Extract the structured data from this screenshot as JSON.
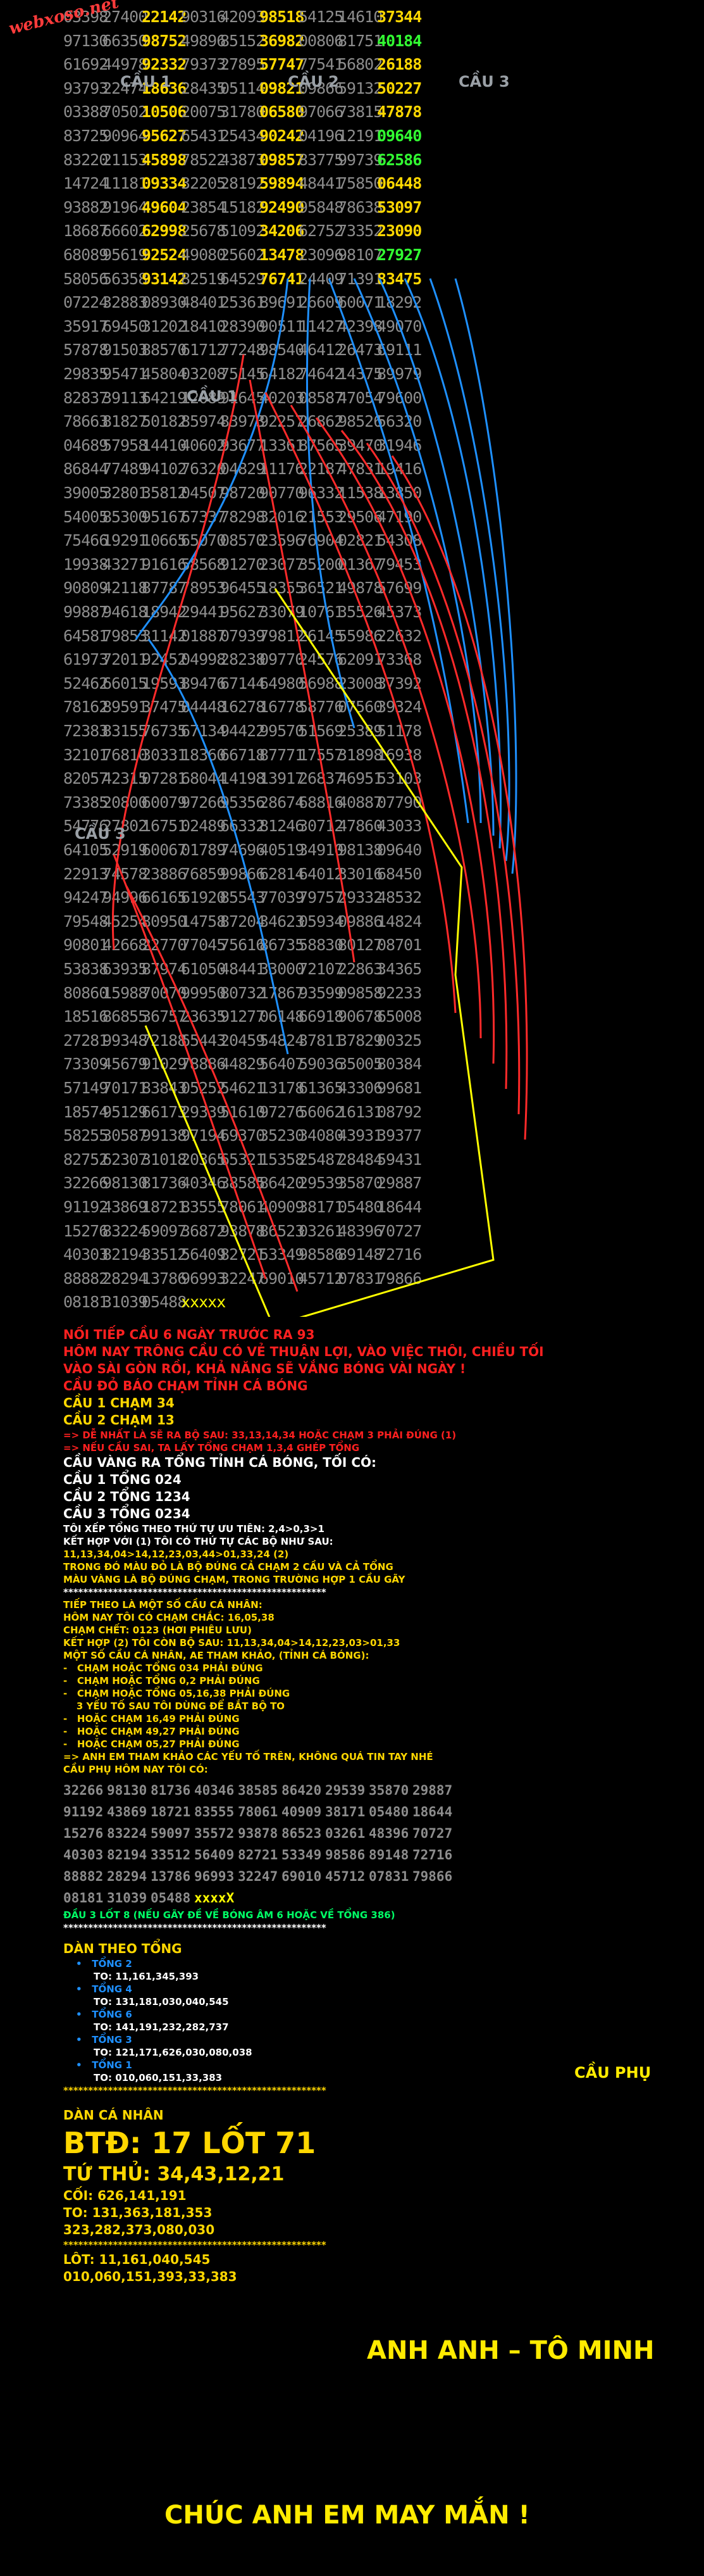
{
  "brand": "webxoso.net",
  "cau_labels": [
    "CẦU 1",
    "CẦU 2",
    "CẦU 3",
    "CẦU 1",
    "CẦU 3",
    "CẦU PHỤ"
  ],
  "grid_rows": [
    [
      "03398",
      "27400",
      "22142",
      "90316",
      "42093",
      "98518",
      "54125",
      "14610",
      "37344"
    ],
    [
      "97130",
      "66350",
      "98752",
      "49896",
      "85152",
      "36982",
      "00806",
      "81751",
      "40184"
    ],
    [
      "61692",
      "44978",
      "92332",
      "79373",
      "27895",
      "57747",
      "77541",
      "56802",
      "26188"
    ],
    [
      "93793",
      "22474",
      "18636",
      "28435",
      "05114",
      "09821",
      "09866",
      "59132",
      "50227"
    ],
    [
      "03388",
      "70502",
      "10506",
      "20075",
      "31780",
      "06580",
      "97066",
      "73815",
      "47878"
    ],
    [
      "83725",
      "90964",
      "95627",
      "65431",
      "25434",
      "90242",
      "04196",
      "12191",
      "09640"
    ],
    [
      "83220",
      "21153",
      "45898",
      "78522",
      "43873",
      "09857",
      "83775",
      "99739",
      "62586"
    ],
    [
      "14724",
      "11181",
      "09334",
      "32205",
      "28192",
      "59894",
      "48441",
      "75850",
      "06448"
    ],
    [
      "93882",
      "91964",
      "49604",
      "23854",
      "15182",
      "92490",
      "95848",
      "78638",
      "53097"
    ],
    [
      "18687",
      "66602",
      "62998",
      "25678",
      "51092",
      "34206",
      "62752",
      "73352",
      "23090"
    ],
    [
      "68089",
      "95619",
      "92524",
      "49080",
      "25602",
      "13478",
      "23096",
      "98107",
      "27927"
    ],
    [
      "58056",
      "56358",
      "93142",
      "82519",
      "64529",
      "76741",
      "24409",
      "71391",
      "83475"
    ],
    [
      "07224",
      "32883",
      "08930",
      "48401",
      "25361",
      "89691",
      "26609",
      "60071",
      "18292"
    ],
    [
      "35917",
      "69450",
      "31202",
      "18410",
      "28390",
      "90511",
      "11427",
      "42398",
      "49070"
    ],
    [
      "57878",
      "91503",
      "88570",
      "61712",
      "77248",
      "98540",
      "46412",
      "26473",
      "69111"
    ],
    [
      "29835",
      "95471",
      "45804",
      "03208",
      "75145",
      "64182",
      "74642",
      "14375",
      "89979"
    ],
    [
      "82837",
      "39113",
      "64219",
      "12089",
      "91645",
      "40203",
      "08587",
      "47054",
      "79600"
    ],
    [
      "78663",
      "81827",
      "50182",
      "85974",
      "83973",
      "92257",
      "26862",
      "98526",
      "56320"
    ],
    [
      "04689",
      "57958",
      "14410",
      "40602",
      "93677",
      "13361",
      "87565",
      "39470",
      "31946"
    ],
    [
      "86844",
      "77489",
      "94102",
      "76320",
      "04829",
      "11176",
      "22187",
      "47831",
      "19416"
    ],
    [
      "39005",
      "32801",
      "35812",
      "04507",
      "98720",
      "90770",
      "96332",
      "11538",
      "13850"
    ],
    [
      "54005",
      "85300",
      "95167",
      "67337",
      "78298",
      "32016",
      "21553",
      "29506",
      "47190"
    ],
    [
      "75466",
      "19291",
      "10665",
      "65070",
      "08570",
      "23596",
      "76904",
      "02821",
      "54308"
    ],
    [
      "19938",
      "43271",
      "91616",
      "58568",
      "91270",
      "23077",
      "35200",
      "01367",
      "79453"
    ],
    [
      "90809",
      "42118",
      "87787",
      "78953",
      "96455",
      "18355",
      "36521",
      "49878",
      "57699"
    ],
    [
      "99887",
      "94618",
      "18942",
      "29441",
      "95627",
      "33079",
      "10761",
      "35526",
      "45373"
    ],
    [
      "64581",
      "79853",
      "31142",
      "01887",
      "07939",
      "79812",
      "26145",
      "55986",
      "22632"
    ],
    [
      "61973",
      "72011",
      "92452",
      "04998",
      "28238",
      "09770",
      "24576",
      "62091",
      "73368"
    ],
    [
      "52462",
      "66015",
      "19593",
      "89476",
      "67144",
      "64980",
      "56988",
      "23008",
      "37392"
    ],
    [
      "78162",
      "89591",
      "37475",
      "04448",
      "16278",
      "16778",
      "58776",
      "07560",
      "39324"
    ],
    [
      "72383",
      "83155",
      "76735",
      "67134",
      "94422",
      "99570",
      "51569",
      "25389",
      "51178"
    ],
    [
      "32101",
      "76810",
      "30331",
      "18360",
      "66718",
      "87771",
      "17557",
      "31898",
      "16938"
    ],
    [
      "82057",
      "42315",
      "07281",
      "68044",
      "14198",
      "13917",
      "26837",
      "46951",
      "53103"
    ],
    [
      "73385",
      "20800",
      "60079",
      "97266",
      "95356",
      "28674",
      "68816",
      "40887",
      "07790"
    ],
    [
      "54776",
      "27802",
      "16751",
      "02489",
      "66332",
      "81246",
      "30712",
      "47860",
      "43033"
    ],
    [
      "64105",
      "52919",
      "60067",
      "01789",
      "74696",
      "40519",
      "34910",
      "98138",
      "09640"
    ],
    [
      "22913",
      "74578",
      "23886",
      "76859",
      "99866",
      "62814",
      "64012",
      "33016",
      "68450"
    ],
    [
      "94247",
      "94996",
      "66165",
      "61920",
      "85543",
      "77039",
      "79757",
      "29332",
      "48532"
    ],
    [
      "79548",
      "45254",
      "80950",
      "14758",
      "87204",
      "34623",
      "05934",
      "09886",
      "14824"
    ],
    [
      "90801",
      "42668",
      "22770",
      "77045",
      "75616",
      "86735",
      "58830",
      "80127",
      "08701"
    ],
    [
      "53838",
      "63935",
      "87974",
      "61050",
      "48441",
      "33000",
      "72107",
      "22863",
      "34365"
    ],
    [
      "80860",
      "15988",
      "70070",
      "99950",
      "80732",
      "17867",
      "93599",
      "09858",
      "92233"
    ],
    [
      "18516",
      "86855",
      "36757",
      "23635",
      "91277",
      "06148",
      "66918",
      "90678",
      "65008"
    ],
    [
      "27281",
      "99348",
      "72188",
      "65443",
      "20459",
      "54824",
      "37811",
      "37829",
      "00325"
    ],
    [
      "73309",
      "45679",
      "91029",
      "78886",
      "44829",
      "56407",
      "59036",
      "35005",
      "80384"
    ],
    [
      "57149",
      "70171",
      "83843",
      "05252",
      "54621",
      "13178",
      "61365",
      "43306",
      "99681"
    ],
    [
      "18574",
      "95129",
      "66173",
      "29339",
      "51610",
      "97276",
      "56062",
      "16131",
      "08792"
    ],
    [
      "58255",
      "30587",
      "99138",
      "97194",
      "69370",
      "35230",
      "34080",
      "43931",
      "39377"
    ],
    [
      "82752",
      "62307",
      "31018",
      "20365",
      "65321",
      "15358",
      "25487",
      "28484",
      "59431"
    ],
    [
      "32266",
      "98130",
      "81736",
      "40346",
      "38585",
      "86420",
      "29539",
      "35870",
      "29887"
    ],
    [
      "91192",
      "43869",
      "18721",
      "83555",
      "78061",
      "40909",
      "38171",
      "05480",
      "18644"
    ],
    [
      "15276",
      "83224",
      "59097",
      "36872",
      "93878",
      "86523",
      "03261",
      "48396",
      "70727"
    ],
    [
      "40303",
      "82194",
      "33512",
      "56409",
      "82721",
      "53349",
      "98586",
      "89148",
      "72716"
    ],
    [
      "88882",
      "28294",
      "13786",
      "96993",
      "32247",
      "69010",
      "45712",
      "07831",
      "79866"
    ],
    [
      "08181",
      "31039",
      "05488",
      "xxxxx"
    ]
  ],
  "analysis_lines": [
    {
      "t": "NỐI TIẾP CẦU 6 NGÀY TRƯỚC RA 93",
      "c": "rd"
    },
    {
      "t": "HÔM NAY TRÔNG CẦU CÓ VẺ THUẬN LỢI, VÀO VIỆC THÔI, CHIỀU TỐI",
      "c": "rd"
    },
    {
      "t": "VÀO SÀI GÒN RỒI, KHẢ NĂNG SẼ VẮNG BÓNG VÀI NGÀY !",
      "c": "rd"
    },
    {
      "t": "CẦU ĐỎ BÁO CHẠM TỈNH CÁ BÓNG",
      "c": "rd"
    },
    {
      "t": "CẦU 1 CHẠM 34",
      "c": "hl"
    },
    {
      "t": "CẦU 2 CHẠM 13",
      "c": "hl"
    },
    {
      "t": "=> DỄ NHẤT LÀ SẼ RA BỘ SAU: 33,13,14,34 HOẶC CHẠM 3 PHẢI ĐÚNG (1)",
      "c": "rd",
      "s": 1
    },
    {
      "t": "=> NẾU CẦU SAI, TA LẤY TỔNG CHẠM 1,3,4 GHÉP TỔNG",
      "c": "rd",
      "s": 1
    },
    {
      "t": "CẦU VÀNG RA TỔNG TỈNH CÁ BÓNG, TỐI CÓ:",
      "c": "wt"
    },
    {
      "t": "CẦU 1 TỔNG 024",
      "c": "wt"
    },
    {
      "t": "CẦU 2 TỔNG 1234",
      "c": "wt"
    },
    {
      "t": "CẦU 3 TỔNG 0234",
      "c": "wt"
    },
    {
      "t": "TÔI XẾP TỔNG THEO THỨ TỰ ƯU TIÊN: 2,4>0,3>1",
      "c": "wt",
      "s": 1
    },
    {
      "t": "KẾT HỢP VỚI (1) TÔI CÓ THỨ TỰ CÁC BỘ NHƯ SAU:",
      "c": "wt",
      "s": 1
    },
    {
      "t": "11,13,34,04>14,12,23,03,44>01,33,24 (2)",
      "c": "hl",
      "s": 1
    },
    {
      "t": "TRONG ĐÓ MÀU ĐỎ LÀ BỘ ĐÚNG CẢ CHẠM 2 CẦU VÀ CẢ TỔNG",
      "c": "hl",
      "s": 1
    },
    {
      "t": "MÀU VÀNG LÀ BỘ ĐÚNG CHẠM, TRONG TRƯỜNG HỢP 1 CẦU GÃY",
      "c": "hl",
      "s": 1
    },
    {
      "t": "*****************************************************",
      "c": "wt",
      "s": 1
    },
    {
      "t": "TIẾP THEO LÀ MỘT SỐ CẦU CÁ NHÂN:",
      "c": "hl",
      "s": 1
    },
    {
      "t": "HÔM NAY TÔI CÓ CHẠM CHẮC: 16,05,38",
      "c": "hl",
      "s": 1
    },
    {
      "t": "CHẠM CHẾT: 0123 (HƠI PHIÊU LƯU)",
      "c": "hl",
      "s": 1
    },
    {
      "t": "KẾT HỢP (2) TÔI CÒN BỘ SAU: 11,13,34,04>14,12,23,03>01,33",
      "c": "hl",
      "s": 1
    },
    {
      "t": "MỘT SỐ CẦU CÁ NHÂN, AE THAM KHẢO, (TỈNH CÁ BÓNG):",
      "c": "hl",
      "s": 1
    },
    {
      "t": "-   CHẠM HOẶC TỔNG 034 PHẢI ĐÚNG",
      "c": "hl",
      "s": 1
    },
    {
      "t": "-   CHẠM HOẶC TỔNG 0,2 PHẢI ĐÚNG",
      "c": "hl",
      "s": 1
    },
    {
      "t": "-   CHẠM HOẶC TỔNG 05,16,38 PHẢI ĐÚNG",
      "c": "hl",
      "s": 1
    },
    {
      "t": "    3 YẾU TỐ SAU TÔI DÙNG ĐỂ BẮT BỘ TO",
      "c": "hl",
      "s": 1
    },
    {
      "t": "-   HOẶC CHẠM 16,49 PHẢI ĐÚNG",
      "c": "hl",
      "s": 1
    },
    {
      "t": "-   HOẶC CHẠM 49,27 PHẢI ĐÚNG",
      "c": "hl",
      "s": 1
    },
    {
      "t": "-   HOẶC CHẠM 05,27 PHẢI ĐÚNG",
      "c": "hl",
      "s": 1
    },
    {
      "t": "=> ANH EM THAM KHẢO CÁC YẾU TỐ TRÊN, KHÔNG QUÁ TIN TAY NHÉ",
      "c": "hl",
      "s": 1
    },
    {
      "t": "CẦU PHỤ HÔM NAY TÔI CÓ:",
      "c": "hl",
      "s": 1
    }
  ],
  "sub_rows": [
    [
      "32266",
      "98130",
      "81736",
      "40346",
      "38585",
      "86420",
      "29539",
      "35870",
      "29887"
    ],
    [
      "91192",
      "43869",
      "18721",
      "83555",
      "78061",
      "40909",
      "38171",
      "05480",
      "18644"
    ],
    [
      "15276",
      "83224",
      "59097",
      "35572",
      "93878",
      "86523",
      "03261",
      "48396",
      "70727"
    ],
    [
      "40303",
      "82194",
      "33512",
      "56409",
      "82721",
      "53349",
      "98586",
      "89148",
      "72716"
    ],
    [
      "88882",
      "28294",
      "13786",
      "96993",
      "32247",
      "69010",
      "45712",
      "07831",
      "79866"
    ],
    [
      "08181",
      "31039",
      "05488",
      "xxxxX"
    ]
  ],
  "sub_note": "ĐẦU 3 LỐT 8 (NẾU GÃY ĐỀ VỀ BÓNG ÂM 6 HOẶC VỀ TỔNG 386)",
  "tong_title": "DÀN THEO TỔNG",
  "tong_groups": [
    {
      "name": "TỔNG 2",
      "val": "TO: 11,161,345,393"
    },
    {
      "name": "TỔNG 4",
      "val": "TO: 131,181,030,040,545"
    },
    {
      "name": "TỔNG 6",
      "val": "TO: 141,191,232,282,737"
    },
    {
      "name": "TỔNG 3",
      "val": "TO: 121,171,626,030,080,038"
    },
    {
      "name": "TỔNG 1",
      "val": "TO: 010,060,151,33,383"
    }
  ],
  "dan_title": "DÀN CÁ NHÂN",
  "btd": "BTĐ: 17 LỐT 71",
  "tu_thu": "TỨ THỦ: 34,43,12,21",
  "coi": "CỐI: 626,141,191",
  "to_line1": "TO: 131,363,181,353",
  "to_line2": "323,282,373,080,030",
  "lot_line1": "LÔT: 11,161,040,545",
  "lot_line2": "010,060,151,393,33,383",
  "signature": "ANH ANH – TÔ MINH",
  "wish": "CHÚC ANH EM MAY MẮN !"
}
